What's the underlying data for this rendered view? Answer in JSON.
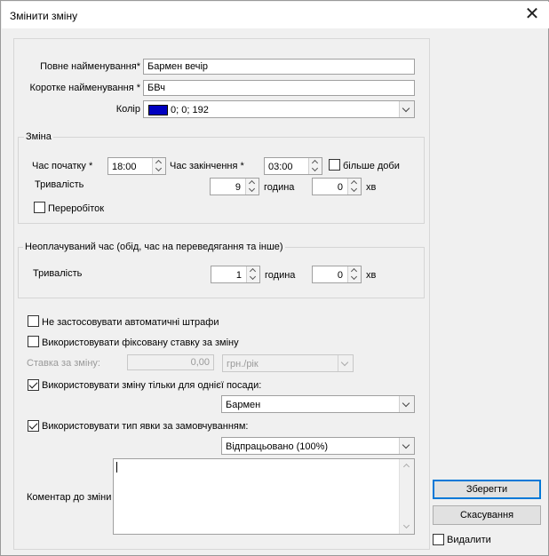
{
  "window": {
    "title": "Змінити зміну"
  },
  "form": {
    "full_name_label": "Повне найменування*",
    "full_name_value": "Бармен вечір",
    "short_name_label": "Коротке найменування *",
    "short_name_value": "БВч",
    "color_label": "Колір",
    "color_value": "0; 0; 192",
    "color_swatch": "#0000c0"
  },
  "shift": {
    "caption": "Зміна",
    "start_label": "Час початку *",
    "start_value": "18:00",
    "end_label": "Час закінчення *",
    "end_value": "03:00",
    "more_than_day_label": "більше доби",
    "more_than_day_checked": false,
    "duration_label": "Тривалість",
    "hours_value": "9",
    "hours_unit": "година",
    "minutes_value": "0",
    "minutes_unit": "хв",
    "overtime_label": "Переробіток",
    "overtime_checked": false
  },
  "unpaid": {
    "caption": "Неоплачуваний час (обід, час на переведягання та інше)",
    "duration_label": "Тривалість",
    "hours_value": "1",
    "hours_unit": "година",
    "minutes_value": "0",
    "minutes_unit": "хв"
  },
  "options": {
    "no_auto_fines_label": "Не застосовувати автоматичні штрафи",
    "no_auto_fines_checked": false,
    "fixed_rate_label": "Використовувати фіксовану ставку за зміну",
    "fixed_rate_checked": false,
    "rate_label": "Ставка за зміну:",
    "rate_value": "0,00",
    "rate_unit": "грн./рік",
    "single_position_label": "Використовувати зміну тільки для однієї посади:",
    "single_position_checked": true,
    "position_value": "Бармен",
    "default_attendance_label": "Використовувати тип явки за замовчуванням:",
    "default_attendance_checked": true,
    "attendance_value": "Відпрацьовано (100%)",
    "comment_label": "Коментар до зміни",
    "comment_value": ""
  },
  "actions": {
    "save_label": "Зберегти",
    "cancel_label": "Скасування",
    "delete_label": "Видалити",
    "delete_checked": false
  },
  "colors": {
    "accent": "#0078d7",
    "dialog_bg": "#f0f0f0"
  }
}
